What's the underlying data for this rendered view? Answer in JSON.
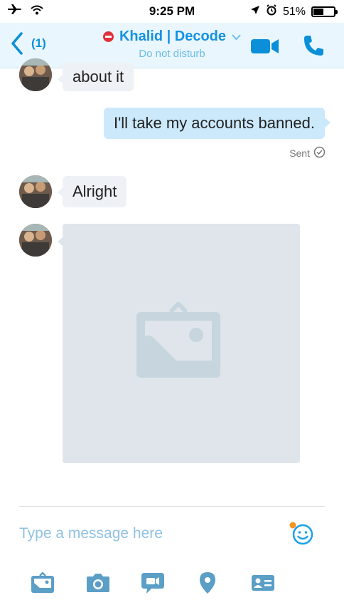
{
  "status_bar": {
    "time": "9:25 PM",
    "battery": "51%",
    "battery_level": 0.51,
    "icons": [
      "airplane-icon",
      "wifi-icon",
      "location-arrow-icon",
      "alarm-icon",
      "battery-icon"
    ]
  },
  "header": {
    "back_count": "(1)",
    "contact_name": "Khalid | Decode",
    "status": "Do not disturb",
    "status_color": "#e0313a",
    "accent": "#1592e0"
  },
  "messages": [
    {
      "direction": "incoming",
      "text": "about it"
    },
    {
      "direction": "outgoing",
      "text": "I'll take my accounts banned.",
      "receipt": "Sent"
    },
    {
      "direction": "incoming",
      "text": "Alright"
    },
    {
      "direction": "incoming",
      "type": "image",
      "icon": "image-placeholder-icon"
    }
  ],
  "composer": {
    "placeholder": "Type a message here",
    "emoji_icon": "emoji-icon"
  },
  "toolbar": {
    "items": [
      "gallery-icon",
      "camera-icon",
      "video-message-icon",
      "location-icon",
      "contact-card-icon"
    ]
  }
}
